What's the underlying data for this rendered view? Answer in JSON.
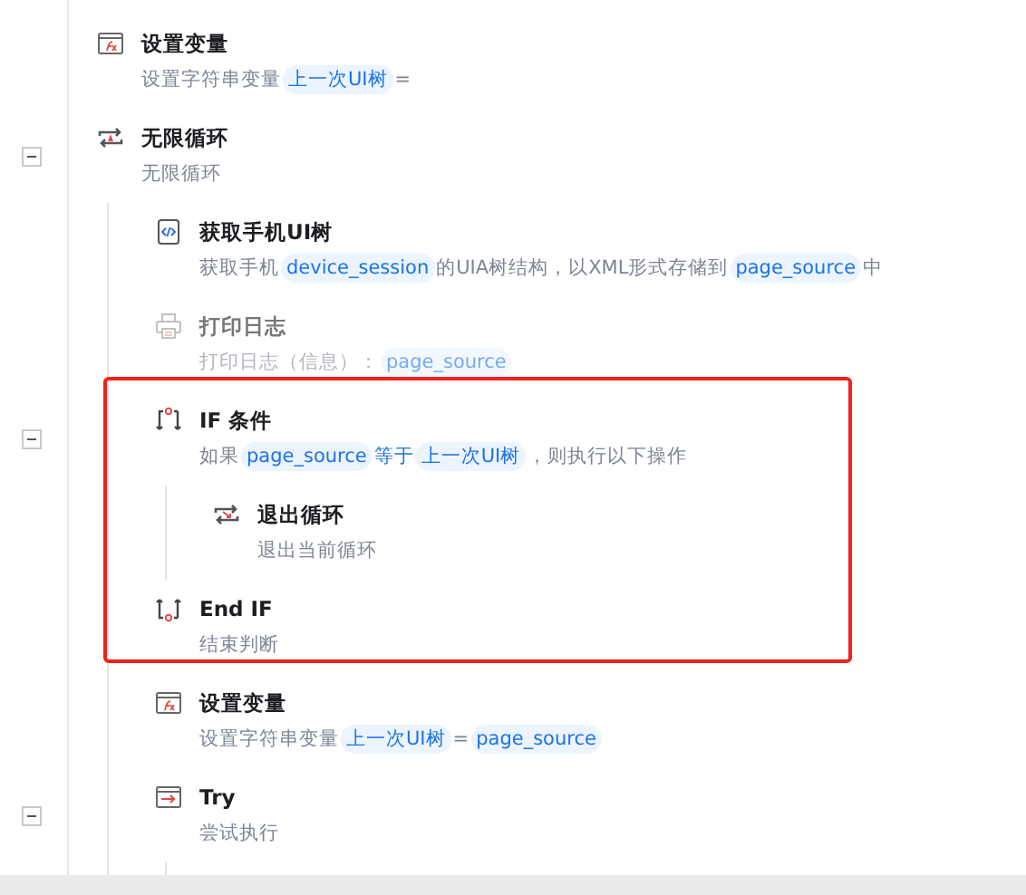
{
  "steps": [
    {
      "kind": "variable",
      "title": "设置变量",
      "disabled": false,
      "expanded": false,
      "description": [
        {
          "kind": "text",
          "text": "设置字符串变量"
        },
        {
          "kind": "chip",
          "text": "上一次UI树"
        },
        {
          "kind": "text",
          "text": "="
        }
      ]
    },
    {
      "kind": "loop",
      "title": "无限循环",
      "disabled": false,
      "expanded": true,
      "description": [
        {
          "kind": "text",
          "text": "无限循环"
        }
      ],
      "children": [
        {
          "kind": "tree",
          "title": "获取手机UI树",
          "disabled": false,
          "expanded": false,
          "description": [
            {
              "kind": "text",
              "text": "获取手机"
            },
            {
              "kind": "chip",
              "text": "device_session"
            },
            {
              "kind": "text",
              "text": "的UIA树结构，以XML形式存储到"
            },
            {
              "kind": "chip",
              "text": "page_source"
            },
            {
              "kind": "text",
              "text": "中"
            }
          ]
        },
        {
          "kind": "print",
          "title": "打印日志",
          "disabled": true,
          "expanded": false,
          "description": [
            {
              "kind": "text",
              "text": "打印日志（信息）："
            },
            {
              "kind": "chip",
              "text": "page_source"
            }
          ]
        },
        {
          "kind": "highlight",
          "children": [
            {
              "kind": "condition",
              "title": "IF 条件",
              "disabled": false,
              "expanded": true,
              "description": [
                {
                  "kind": "text",
                  "text": "如果"
                },
                {
                  "kind": "chip",
                  "text": "page_source"
                },
                {
                  "kind": "operator",
                  "text": "等于"
                },
                {
                  "kind": "chip",
                  "text": "上一次UI树"
                },
                {
                  "kind": "text",
                  "text": "，则执行以下操作"
                }
              ],
              "children": [
                {
                  "kind": "exit",
                  "title": "退出循环",
                  "disabled": false,
                  "expanded": false,
                  "description": [
                    {
                      "kind": "text",
                      "text": "退出当前循环"
                    }
                  ]
                }
              ]
            },
            {
              "kind": "endif",
              "title": "End IF",
              "disabled": false,
              "expanded": false,
              "description": [
                {
                  "kind": "text",
                  "text": "结束判断"
                }
              ]
            }
          ]
        },
        {
          "kind": "variable",
          "title": "设置变量",
          "disabled": false,
          "expanded": false,
          "description": [
            {
              "kind": "text",
              "text": "设置字符串变量"
            },
            {
              "kind": "chip",
              "text": "上一次UI树"
            },
            {
              "kind": "text",
              "text": "="
            },
            {
              "kind": "chip",
              "text": "page_source"
            }
          ]
        },
        {
          "kind": "try",
          "title": "Try",
          "disabled": false,
          "expanded": true,
          "description": [
            {
              "kind": "text",
              "text": "尝试执行"
            }
          ]
        }
      ]
    }
  ]
}
